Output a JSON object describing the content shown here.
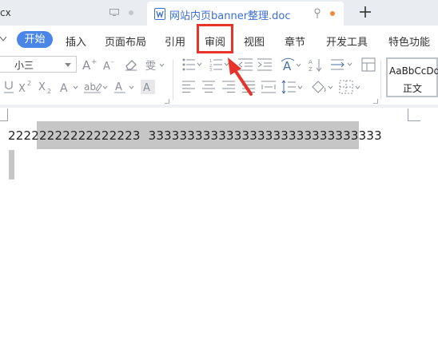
{
  "tabs": {
    "previous": {
      "label": "cx"
    },
    "active": {
      "label": "网站内页banner整理.doc"
    }
  },
  "menu": {
    "items": [
      "开始",
      "插入",
      "页面布局",
      "引用",
      "审阅",
      "视图",
      "章节",
      "开发工具",
      "特色功能"
    ],
    "active_index": 0,
    "highlighted_index": 4
  },
  "ribbon": {
    "font_size": "小三",
    "style": {
      "preview": "AaBbCcDd",
      "name": "正文"
    }
  },
  "document": {
    "line1": "22222222222222223  333333333333333333333333333333"
  },
  "colors": {
    "accent": "#4a86e8",
    "highlight": "#e8332b",
    "selection": "#c6c6c6"
  }
}
